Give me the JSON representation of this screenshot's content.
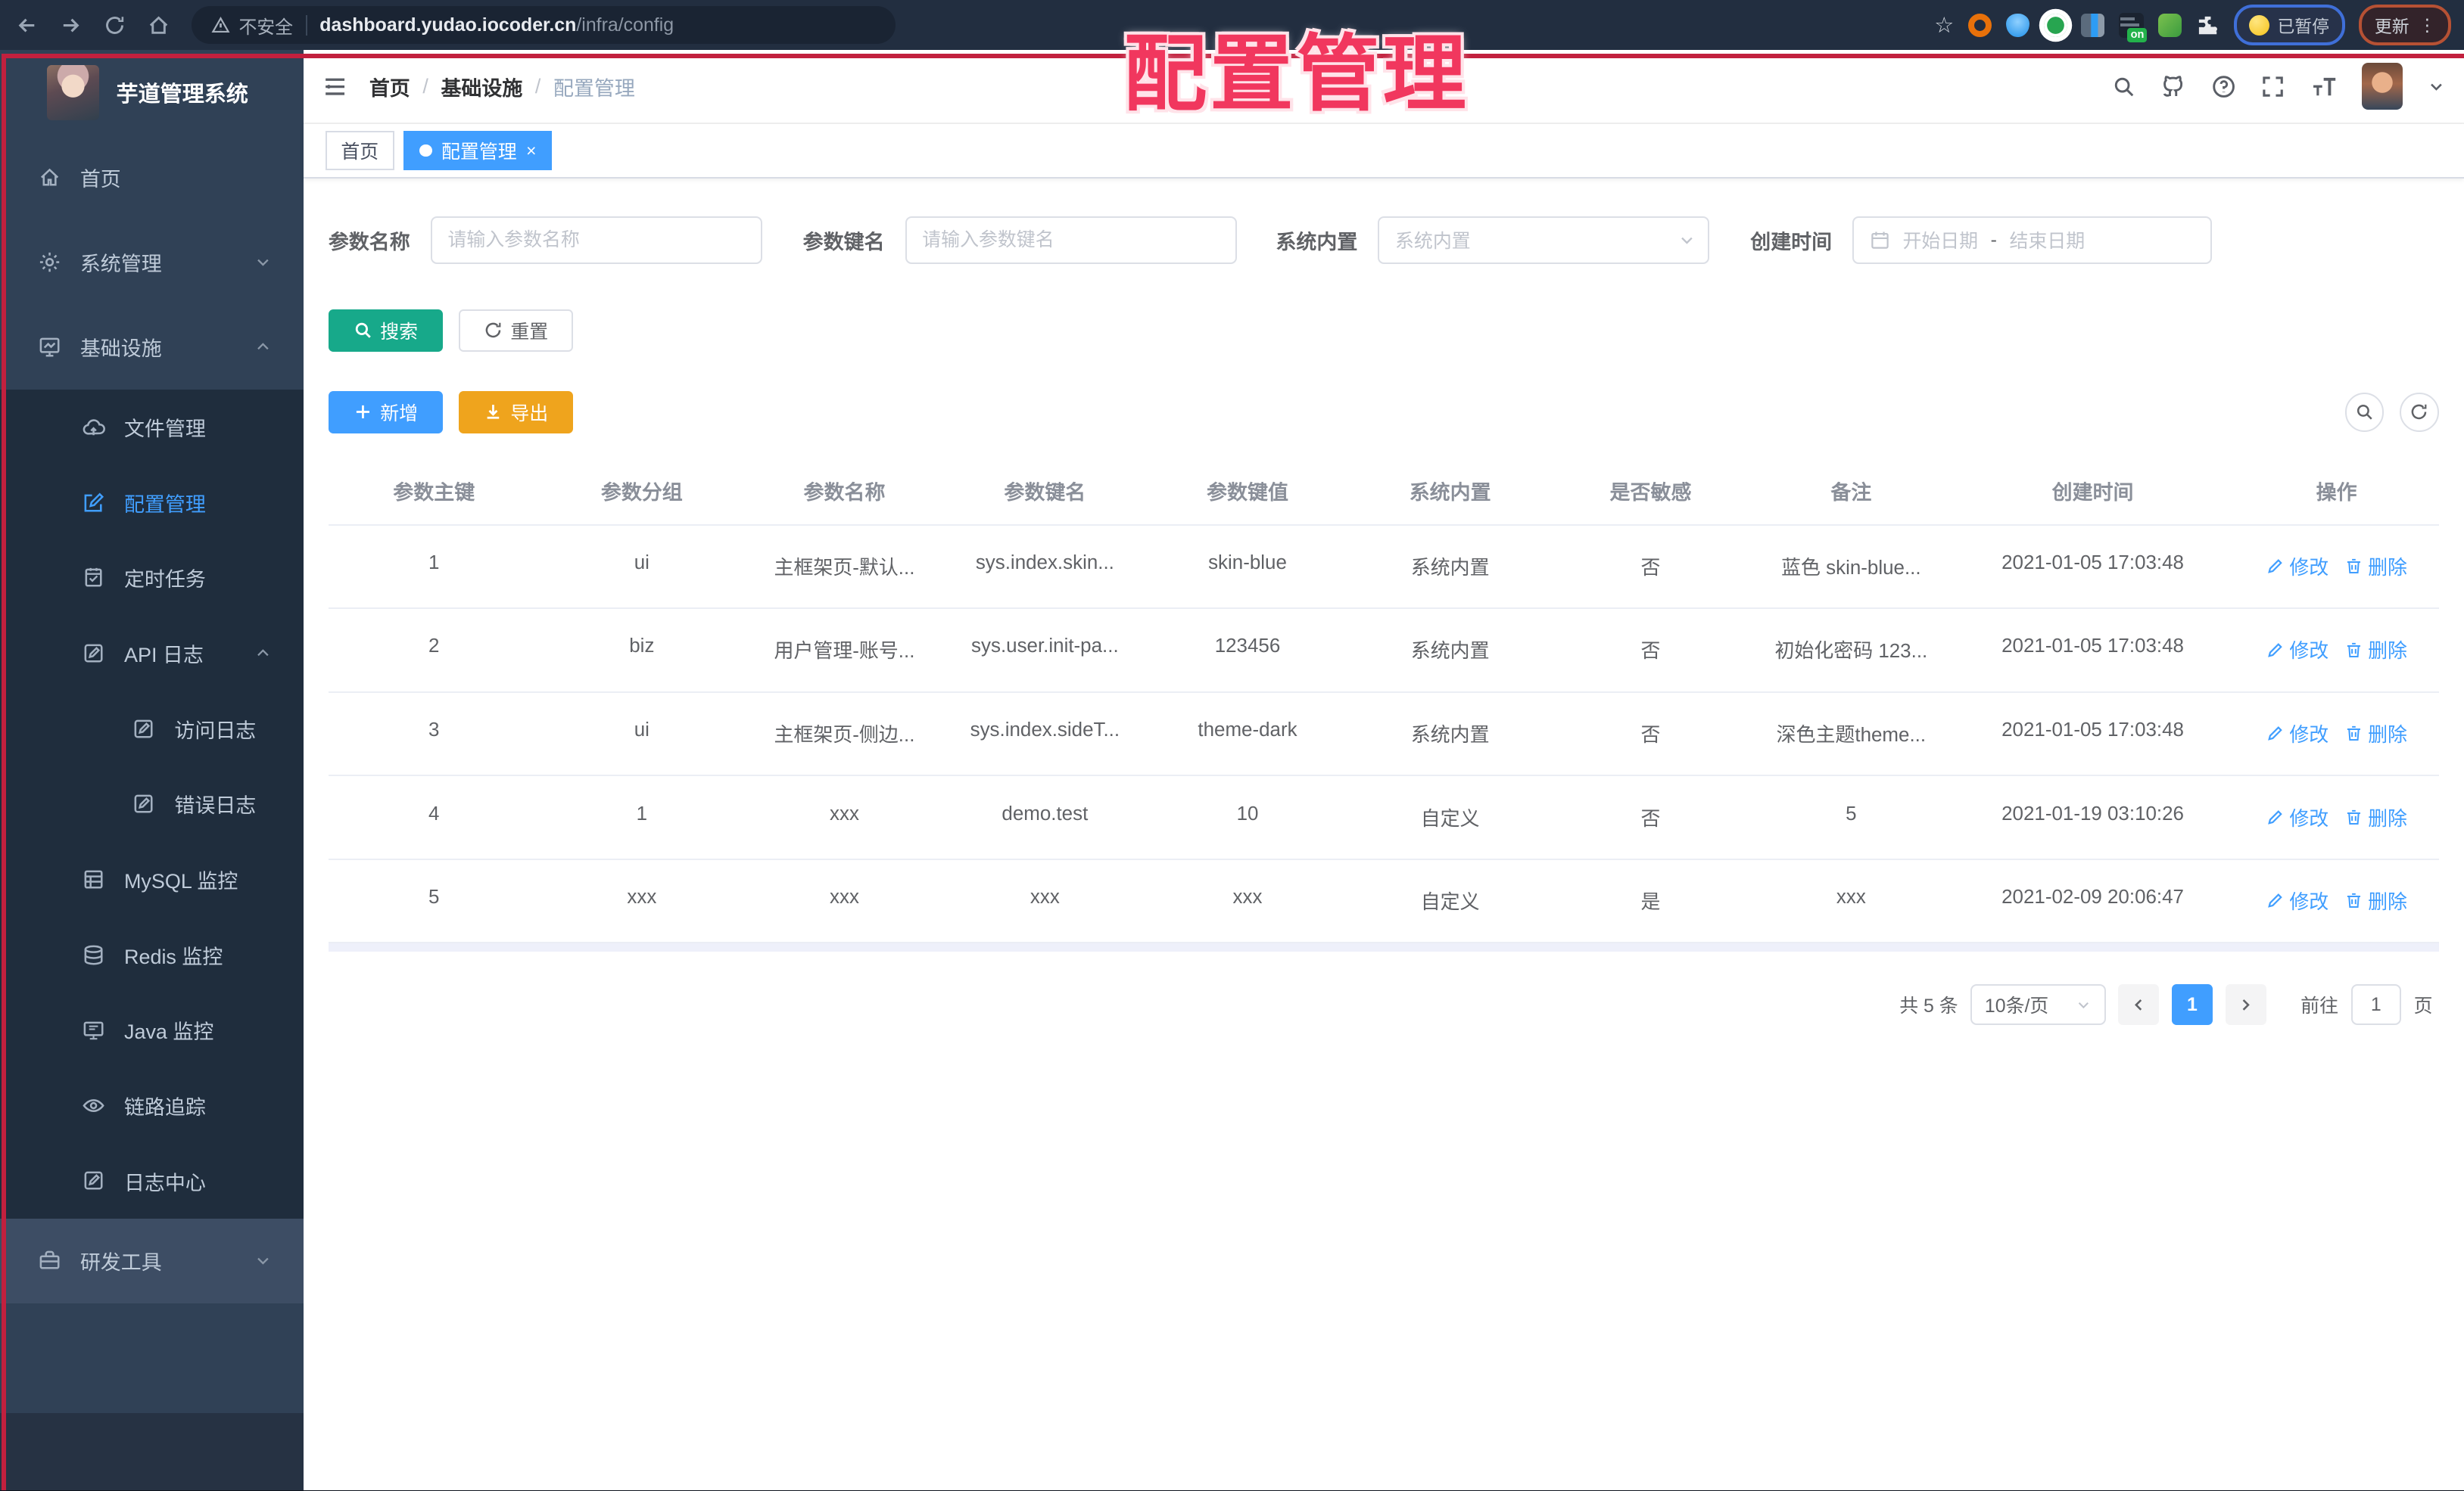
{
  "browser": {
    "security_label": "不安全",
    "url_host": "dashboard.yudao.iocoder.cn",
    "url_path": "/infra/config",
    "ext_on_badge": "on",
    "paused_chip": "已暂停",
    "update_button": "更新"
  },
  "annotation": {
    "label": "配置管理"
  },
  "sidebar": {
    "title": "芋道管理系统",
    "items": [
      {
        "label": "首页",
        "icon": "home-icon",
        "depth": 0
      },
      {
        "label": "系统管理",
        "icon": "gear-icon",
        "depth": 0,
        "caret": "down"
      },
      {
        "label": "基础设施",
        "icon": "infra-icon",
        "depth": 0,
        "caret": "up"
      },
      {
        "label": "文件管理",
        "icon": "cloud-icon",
        "depth": 1
      },
      {
        "label": "配置管理",
        "icon": "edit-icon",
        "depth": 1,
        "active": true
      },
      {
        "label": "定时任务",
        "icon": "schedule-icon",
        "depth": 1
      },
      {
        "label": "API 日志",
        "icon": "log-icon",
        "depth": 1,
        "caret": "up"
      },
      {
        "label": "访问日志",
        "icon": "log-icon",
        "depth": 2
      },
      {
        "label": "错误日志",
        "icon": "log-icon",
        "depth": 2
      },
      {
        "label": "MySQL 监控",
        "icon": "mysql-icon",
        "depth": 1
      },
      {
        "label": "Redis 监控",
        "icon": "redis-icon",
        "depth": 1
      },
      {
        "label": "Java 监控",
        "icon": "java-icon",
        "depth": 1
      },
      {
        "label": "链路追踪",
        "icon": "eye-icon",
        "depth": 1
      },
      {
        "label": "日志中心",
        "icon": "log-icon",
        "depth": 1
      },
      {
        "label": "研发工具",
        "icon": "tools-icon",
        "depth": 0,
        "caret": "down",
        "section": "light"
      }
    ]
  },
  "header": {
    "breadcrumb": [
      "首页",
      "基础设施",
      "配置管理"
    ],
    "separator": "/"
  },
  "tabs": [
    {
      "label": "首页",
      "active": false
    },
    {
      "label": "配置管理",
      "active": true,
      "closable": true
    }
  ],
  "filters": {
    "name_label": "参数名称",
    "name_placeholder": "请输入参数名称",
    "key_label": "参数键名",
    "key_placeholder": "请输入参数键名",
    "type_label": "系统内置",
    "type_placeholder": "系统内置",
    "date_label": "创建时间",
    "date_start": "开始日期",
    "date_sep": "-",
    "date_end": "结束日期"
  },
  "actions": {
    "search": "搜索",
    "reset": "重置",
    "add": "新增",
    "export": "导出"
  },
  "table": {
    "headers": [
      "参数主键",
      "参数分组",
      "参数名称",
      "参数键名",
      "参数键值",
      "系统内置",
      "是否敏感",
      "备注",
      "创建时间",
      "操作"
    ],
    "edit_label": "修改",
    "delete_label": "删除",
    "rows": [
      {
        "cells": [
          "1",
          "ui",
          "主框架页-默认...",
          "sys.index.skin...",
          "skin-blue",
          "系统内置",
          "否",
          "蓝色 skin-blue...",
          "2021-01-05 17:03:48"
        ]
      },
      {
        "cells": [
          "2",
          "biz",
          "用户管理-账号...",
          "sys.user.init-pa...",
          "123456",
          "系统内置",
          "否",
          "初始化密码 123...",
          "2021-01-05 17:03:48"
        ]
      },
      {
        "cells": [
          "3",
          "ui",
          "主框架页-侧边...",
          "sys.index.sideT...",
          "theme-dark",
          "系统内置",
          "否",
          "深色主题theme...",
          "2021-01-05 17:03:48"
        ]
      },
      {
        "cells": [
          "4",
          "1",
          "xxx",
          "demo.test",
          "10",
          "自定义",
          "否",
          "5",
          "2021-01-19 03:10:26"
        ]
      },
      {
        "cells": [
          "5",
          "xxx",
          "xxx",
          "xxx",
          "xxx",
          "自定义",
          "是",
          "xxx",
          "2021-02-09 20:06:47"
        ]
      }
    ]
  },
  "pagination": {
    "total": "共 5 条",
    "page_size": "10条/页",
    "current": "1",
    "goto_label": "前往",
    "goto_value": "1",
    "page_unit": "页"
  },
  "colors": {
    "primary": "#409eff",
    "success": "#17a98a",
    "warning": "#efa41d",
    "annotation": "#f1375e",
    "sidebar_bg": "#304156",
    "submenu_bg": "#1f2d3d"
  }
}
